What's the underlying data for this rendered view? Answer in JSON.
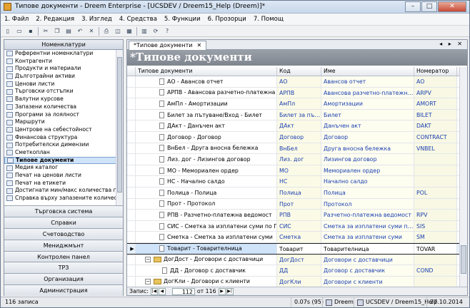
{
  "window": {
    "title": "Типове документи - Dreem Enterprise - [UCSDEV / Dreem15_Help (Dreem)]*",
    "buttons": {
      "minimize": "–",
      "maximize": "□",
      "close": "✕"
    }
  },
  "menu": [
    "1. Файл",
    "2. Редакция",
    "3. Изглед",
    "4. Средства",
    "5. Функции",
    "6. Прозорци",
    "7. Помощ"
  ],
  "toolbar_icons": [
    "new-icon",
    "open-icon",
    "save-icon",
    "cut-icon",
    "copy-icon",
    "paste-icon",
    "undo-icon",
    "delete-icon",
    "print-icon",
    "preview-icon",
    "report-icon",
    "calendar-icon",
    "refresh-icon",
    "help-icon"
  ],
  "left_panel": {
    "header": "Номенклатури",
    "items": [
      "Референтни номенклатури",
      "Контрагенти",
      "Продукти и материали",
      "Дълготрайни активи",
      "Ценови листи",
      "Търговски отстъпки",
      "Валутни курсове",
      "Запазени количества",
      "Програми за лоялност",
      "Маршрути",
      "Центрове на себестойност",
      "Финансова структура",
      "Потребителски димензии",
      "Сметкоплан",
      "Типове документи",
      "Медия каталог",
      "Печат на ценови листи",
      "Печат на етикети",
      "Достигнати мин/макс количества по ...",
      "Справка върху запазените количества"
    ],
    "selected_index": 14,
    "sections": [
      "Търговска система",
      "Справки",
      "Счетоводство",
      "Мениджмънт",
      "Контролен панел",
      "ТРЗ",
      "Организация",
      "Администрация"
    ]
  },
  "tab": {
    "label": "*Типове документи",
    "close": "✕",
    "nav": "◂ ▸ ✕"
  },
  "doc_title": "*Типове документи",
  "grid": {
    "columns": [
      "Типове документи",
      "Код",
      "Име",
      "Номератор"
    ],
    "rows": [
      {
        "name": "АО - Авансов отчет",
        "code": "АО",
        "cname": "Авансов отчет",
        "num": "AO"
      },
      {
        "name": "АРПВ - Авансова разчетно-платежна ве...",
        "code": "АРПВ",
        "cname": "Авансова разчетно-платежна ве...",
        "num": "ARPV"
      },
      {
        "name": "АмПл - Амортизации",
        "code": "АмПл",
        "cname": "Амортизации",
        "num": "AMORT"
      },
      {
        "name": "Билет за пътуване/Вход - Билет",
        "code": "Билет за пъту...",
        "cname": "Билет",
        "num": "BILET"
      },
      {
        "name": "ДАкт - Данъчен акт",
        "code": "ДАкт",
        "cname": "Данъчен акт",
        "num": "DAKT"
      },
      {
        "name": "Договор - Договор",
        "code": "Договор",
        "cname": "Договор",
        "num": "CONTRACT"
      },
      {
        "name": "ВнБел - Друга вносна бележка",
        "code": "ВнБел",
        "cname": "Друга вносна бележка",
        "num": "VNBEL"
      },
      {
        "name": "Лиз. дог - Лизингов договор",
        "code": "Лиз. дог",
        "cname": "Лизингов договор",
        "num": ""
      },
      {
        "name": "МО - Мемориален ордер",
        "code": "МО",
        "cname": "Мемориален ордер",
        "num": ""
      },
      {
        "name": "НС - Начално салдо",
        "code": "НС",
        "cname": "Начално салдо",
        "num": ""
      },
      {
        "name": "Полица - Полица",
        "code": "Полица",
        "cname": "Полица",
        "num": "POL"
      },
      {
        "name": "Прот - Протокол",
        "code": "Прот",
        "cname": "Протокол",
        "num": ""
      },
      {
        "name": "РПВ - Разчетно-платежна ведомост",
        "code": "РПВ",
        "cname": "Разчетно-платежна ведомост",
        "num": "RPV"
      },
      {
        "name": "СИС - Сметка за изплатени суми по ГД",
        "code": "СИС",
        "cname": "Сметка за изплатени суми по ГД",
        "num": "SIS"
      },
      {
        "name": "Сметка - Сметка за изплатени суми",
        "code": "Сметка",
        "cname": "Сметка за изплатени суми",
        "num": "SM"
      },
      {
        "name": "Товарит - Товарителница",
        "code": "Товарит",
        "cname": "Товарителница",
        "num": "TOVAR",
        "current": true
      },
      {
        "name": "ДогДост - Договори с доставчици",
        "code": "ДогДост",
        "cname": "Договори с доставчици",
        "num": "",
        "folder": true
      },
      {
        "name": "ДД - Договор с доставчик",
        "code": "ДД",
        "cname": "Договор с доставчик",
        "num": "COND",
        "child": true
      },
      {
        "name": "ДогКли - Договори с клиенти",
        "code": "ДогКли",
        "cname": "Договори с клиенти",
        "num": "",
        "folder": true
      },
      {
        "name": "ДК - Договор с клиент",
        "code": "ДК",
        "cname": "Договор с клиент",
        "num": "CONC",
        "child": true
      }
    ]
  },
  "record_nav": {
    "label": "Запис:",
    "current": "112",
    "of_label": "от 116"
  },
  "status": {
    "records": "116 записа",
    "time": "0.07s (95)",
    "app": "Dreem",
    "db": "UCSDEV / Dreem15_Help",
    "date": "27.10.2014"
  }
}
